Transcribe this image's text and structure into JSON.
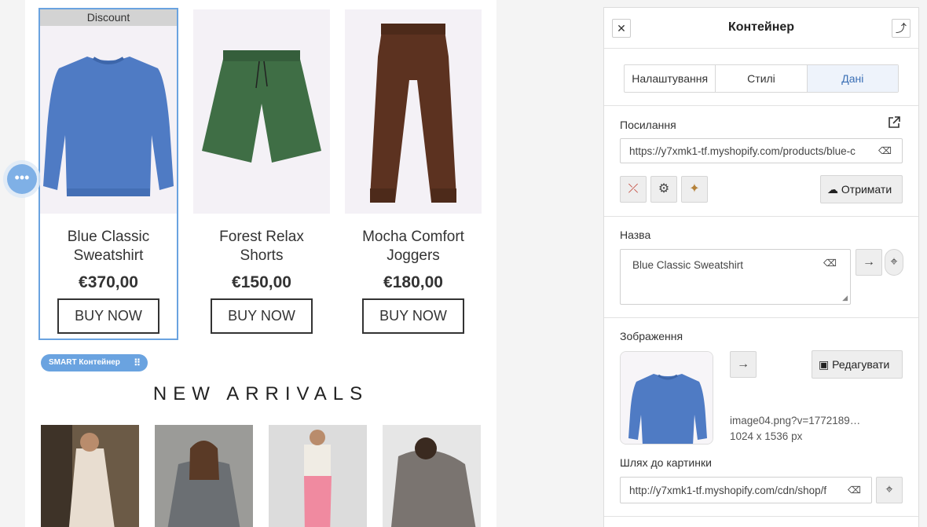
{
  "products": [
    {
      "discount_label": "Discount",
      "title_line1": "Blue Classic",
      "title_line2": "Sweatshirt",
      "price": "€370,00",
      "buy": "BUY NOW"
    },
    {
      "title_line1": "Forest Relax",
      "title_line2": "Shorts",
      "price": "€150,00",
      "buy": "BUY NOW"
    },
    {
      "title_line1": "Mocha Comfort",
      "title_line2": "Joggers",
      "price": "€180,00",
      "buy": "BUY NOW"
    }
  ],
  "smart_container_label": "SMART Контейнер",
  "section_heading": "NEW ARRIVALS",
  "panel": {
    "title": "Контейнер",
    "tabs": [
      "Налаштування",
      "Стилі",
      "Дані"
    ],
    "active_tab": "Дані",
    "link": {
      "label": "Посилання",
      "value": "https://y7xmk1-tf.myshopify.com/products/blue-c",
      "fetch_button": "Отримати"
    },
    "name": {
      "label": "Назва",
      "value": "Blue Classic Sweatshirt"
    },
    "image": {
      "label": "Зображення",
      "edit_button": "Редагувати",
      "filename": "image04.png?v=1772189…",
      "dimensions": "1024 x 1536 px"
    },
    "image_path": {
      "label": "Шлях до картинки",
      "value": "http://y7xmk1-tf.myshopify.com/cdn/shop/f"
    }
  },
  "colors": {
    "accent": "#6aa3e0",
    "sweatshirt": "#4f7bc4",
    "shorts": "#3f6e45",
    "joggers": "#5c3220"
  }
}
